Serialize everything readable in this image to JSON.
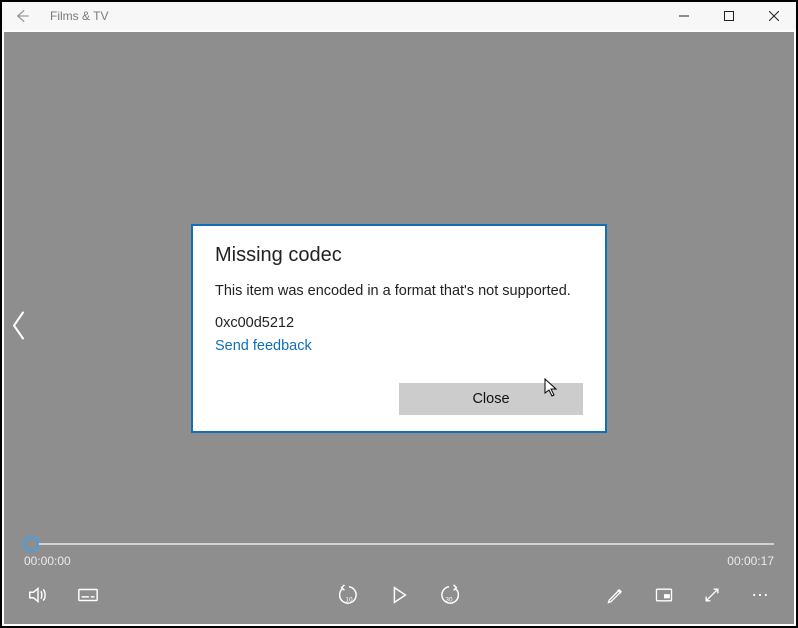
{
  "window": {
    "title": "Films & TV"
  },
  "dialog": {
    "title": "Missing codec",
    "message": "This item was encoded in a format that's not supported.",
    "error_code": "0xc00d5212",
    "feedback_link": "Send feedback",
    "close_label": "Close"
  },
  "player": {
    "current_time": "00:00:00",
    "duration": "00:00:17"
  },
  "icons": {
    "back": "back-arrow-icon",
    "minimize": "minimize-icon",
    "maximize": "maximize-icon",
    "close_window": "close-window-icon",
    "prev_chapter": "chevron-left-icon",
    "volume": "volume-icon",
    "subtitles": "subtitles-icon",
    "skip_back": "skip-back-10-icon",
    "play": "play-icon",
    "skip_forward": "skip-forward-30-icon",
    "edit": "pencil-icon",
    "mini_view": "mini-view-icon",
    "fullscreen": "fullscreen-icon",
    "more": "more-icon"
  }
}
